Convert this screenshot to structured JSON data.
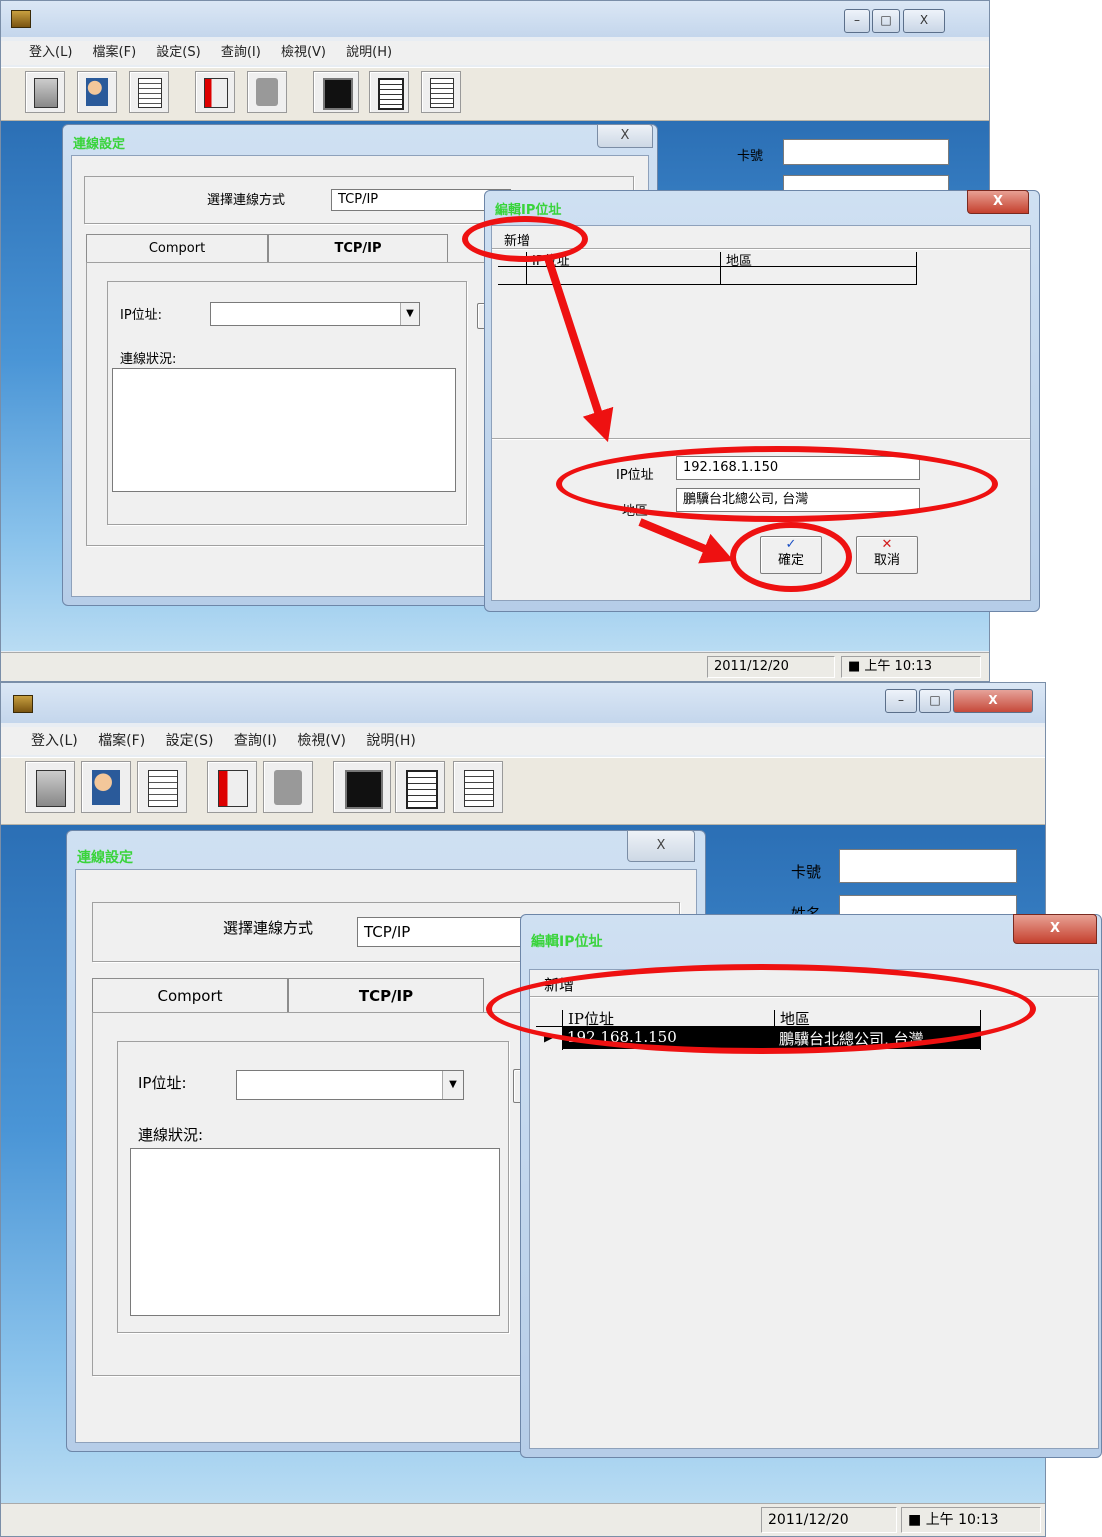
{
  "app": {
    "menu": [
      "登入(L)",
      "檔案(F)",
      "設定(S)",
      "查詢(I)",
      "檢視(V)",
      "說明(H)"
    ],
    "toolbar_icons": [
      "calculator-icon",
      "user-edit-icon",
      "document-icon",
      "import-icon",
      "export-icon",
      "monitor-icon",
      "clipboard-icon",
      "report-icon"
    ],
    "side_labels": {
      "card_no": "卡號",
      "name": "姓名"
    },
    "status": {
      "date": "2011/12/20",
      "time": "上午 10:13"
    },
    "window_buttons": {
      "minimize": "–",
      "maximize": "□",
      "close": "X"
    }
  },
  "connection_dialog": {
    "title": "連線設定",
    "close": "X",
    "method_label": "選擇連線方式",
    "method_value": "TCP/IP",
    "tabs": [
      "Comport",
      "TCP/IP"
    ],
    "ip_label": "IP位址:",
    "status_label": "連線狀況:"
  },
  "edit_ip_dialog": {
    "title": "編輯IP位址",
    "close": "X",
    "add_button": "新增",
    "columns": [
      "IP位址",
      "地區"
    ],
    "ip_label": "IP位址",
    "region_label": "地區",
    "ip_value": "192.168.1.150",
    "region_value": "鵬驥台北總公司, 台灣",
    "ok_button": "確定",
    "cancel_button": "取消",
    "rows": [
      {
        "ip": "192.168.1.150",
        "region": "鵬驥台北總公司, 台灣"
      }
    ]
  },
  "colors": {
    "annotation": "#ee1111",
    "dialog_title": "#39d43b",
    "selected_row": "#000000"
  }
}
